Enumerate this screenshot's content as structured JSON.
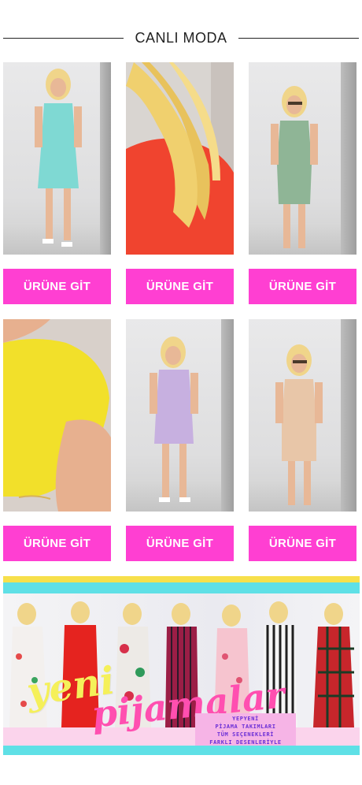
{
  "section": {
    "title": "CANLI MODA"
  },
  "products": [
    {
      "button_label": "ÜRÜNE GİT",
      "photo_icon": "dress-mint-icon",
      "dress_color": "#7fd9d3"
    },
    {
      "button_label": "ÜRÜNE GİT",
      "photo_icon": "dress-red-closeup-icon",
      "dress_color": "#f0442f"
    },
    {
      "button_label": "ÜRÜNE GİT",
      "photo_icon": "dress-sage-icon",
      "dress_color": "#8fb596"
    },
    {
      "button_label": "ÜRÜNE GİT",
      "photo_icon": "dress-yellow-closeup-icon",
      "dress_color": "#f2e02a"
    },
    {
      "button_label": "ÜRÜNE GİT",
      "photo_icon": "dress-lilac-icon",
      "dress_color": "#c7b0e0"
    },
    {
      "button_label": "ÜRÜNE GİT",
      "photo_icon": "dress-beige-icon",
      "dress_color": "#e8c6a8"
    }
  ],
  "banner": {
    "headline_1": "yeni",
    "headline_2": "pijamalar",
    "promo_lines": [
      "YEPYENİ",
      "PİJAMA TAKIMLARI",
      "TÜM SEÇENEKLERİ",
      "FARKLI DESENLERİYLE"
    ]
  },
  "colors": {
    "button_bg": "#ff3fd2",
    "button_text": "#ffffff",
    "banner_cyan": "#5fe0e6",
    "banner_yellow": "#f7e04b",
    "banner_pink": "#ff4fb0"
  }
}
